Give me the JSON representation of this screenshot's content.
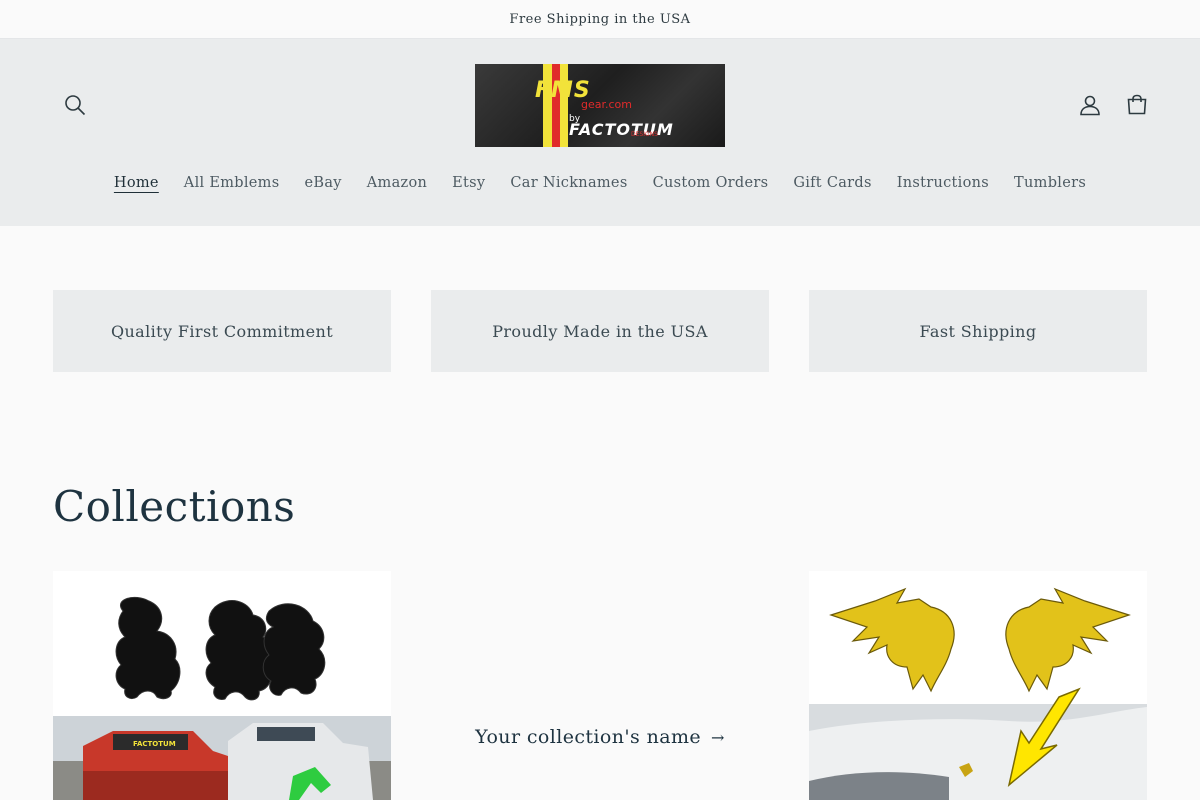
{
  "announcement": "Free Shipping in the USA",
  "logo": {
    "main": "FMS",
    "sub": "gear.com",
    "by": "by",
    "brand": "FACTOTUM",
    "tag": "DESIGNS"
  },
  "header": {
    "search_icon": "search-icon",
    "account_icon": "account-icon",
    "cart_icon": "cart-icon"
  },
  "nav": {
    "items": [
      {
        "label": "Home",
        "active": true
      },
      {
        "label": "All Emblems"
      },
      {
        "label": "eBay"
      },
      {
        "label": "Amazon"
      },
      {
        "label": "Etsy"
      },
      {
        "label": "Car Nicknames"
      },
      {
        "label": "Custom Orders"
      },
      {
        "label": "Gift Cards"
      },
      {
        "label": "Instructions"
      },
      {
        "label": "Tumblers"
      }
    ]
  },
  "features": [
    "Quality First Commitment",
    "Proudly Made in the USA",
    "Fast Shipping"
  ],
  "collections": {
    "title": "Collections",
    "placeholder_link": "Your collection's name",
    "arrow": "→",
    "card1_banner": "FACTOTUM"
  },
  "colors": {
    "header_bg": "#eaeced",
    "accent_text": "#1e3340",
    "logo_yellow": "#f2e33a",
    "logo_red": "#e02b2b"
  }
}
